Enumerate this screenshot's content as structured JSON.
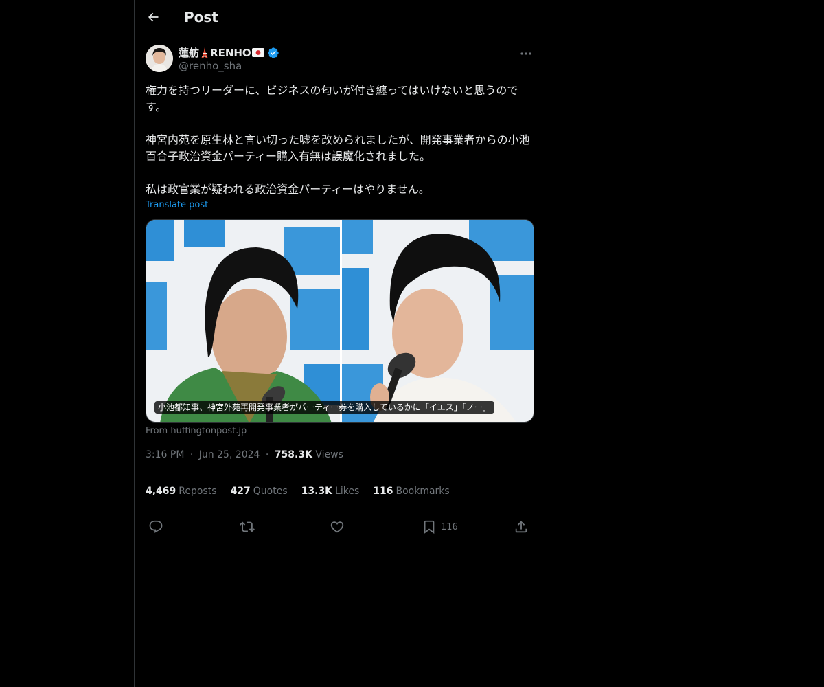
{
  "header": {
    "title": "Post",
    "back_icon": "arrow-left-icon"
  },
  "author": {
    "name": "蓮舫",
    "name_suffix": "RENHO",
    "emoji_1": "tokyo-tower-emoji",
    "emoji_2": "japan-flag-emoji",
    "verified": true,
    "verified_color": "#1d9bf0",
    "handle": "@renho_sha"
  },
  "tweet": {
    "paragraphs": [
      "権力を持つリーダーに、ビジネスの匂いが付き纏ってはいけないと思うのです。",
      "神宮内苑を原生林と言い切った嘘を改められましたが、開発事業者からの小池百合子政治資金パーティー購入有無は誤魔化されました。",
      "私は政官業が疑われる政治資金パーティーはやりません。"
    ],
    "translate_label": "Translate post"
  },
  "media": {
    "caption": "小池都知事、神宮外苑再開発事業者がパーティー券を購入しているかに「イエス」「ノー」",
    "source": "From huffingtonpost.jp"
  },
  "meta": {
    "time": "3:16 PM",
    "date": "Jun 25, 2024",
    "views_count": "758.3K",
    "views_label": "Views",
    "separator": "·"
  },
  "stats": {
    "reposts_count": "4,469",
    "reposts_label": "Reposts",
    "quotes_count": "427",
    "quotes_label": "Quotes",
    "likes_count": "13.3K",
    "likes_label": "Likes",
    "bookmarks_count": "116",
    "bookmarks_label": "Bookmarks"
  },
  "actions": {
    "reply_icon": "reply-icon",
    "repost_icon": "repost-icon",
    "like_icon": "heart-icon",
    "bookmark_icon": "bookmark-icon",
    "bookmark_count": "116",
    "share_icon": "share-icon"
  },
  "colors": {
    "background": "#000000",
    "text": "#e7e9ea",
    "secondary": "#71767b",
    "accent": "#1d9bf0",
    "border": "#2f3336"
  }
}
